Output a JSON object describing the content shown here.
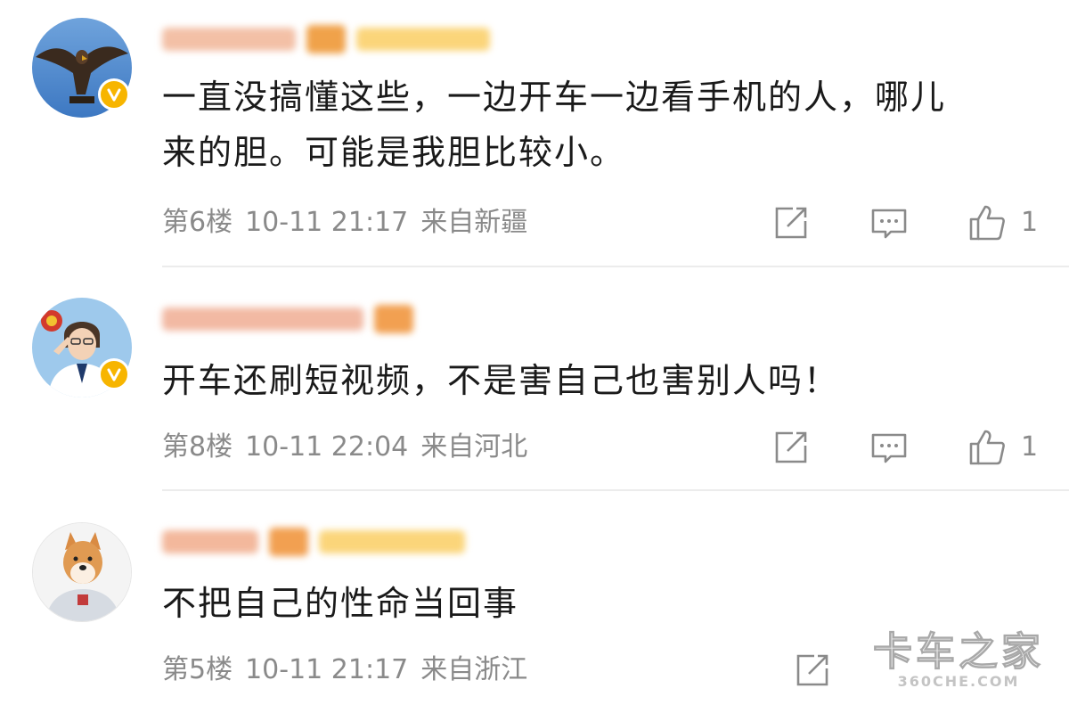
{
  "comments": [
    {
      "text_lines": [
        "一直没搞懂这些，一边开车一边看手机的人，哪儿",
        "来的胆。可能是我胆比较小。"
      ],
      "floor": "第6楼",
      "time": "10-11 21:17",
      "location": "来自新疆",
      "likes": "1",
      "verified": true,
      "avatar_icon": "eagle-avatar"
    },
    {
      "text_lines": [
        "开车还刷短视频，不是害自己也害别人吗！"
      ],
      "floor": "第8楼",
      "time": "10-11 22:04",
      "location": "来自河北",
      "likes": "1",
      "verified": true,
      "avatar_icon": "officer-avatar"
    },
    {
      "text_lines": [
        "不把自己的性命当回事"
      ],
      "floor": "第5楼",
      "time": "10-11 21:17",
      "location": "来自浙江",
      "likes": "",
      "verified": false,
      "avatar_icon": "shiba-avatar"
    }
  ],
  "icons": {
    "share": "share-icon",
    "reply": "comment-icon",
    "like": "thumbs-up-icon",
    "verified": "verified-v-badge-icon"
  },
  "colors": {
    "text": "#1a1a1a",
    "meta": "#8a8a8a",
    "verified_badge": "#f7b500",
    "divider": "#ececec"
  },
  "watermark": {
    "main": "卡车之家",
    "sub": "360CHE.COM"
  }
}
